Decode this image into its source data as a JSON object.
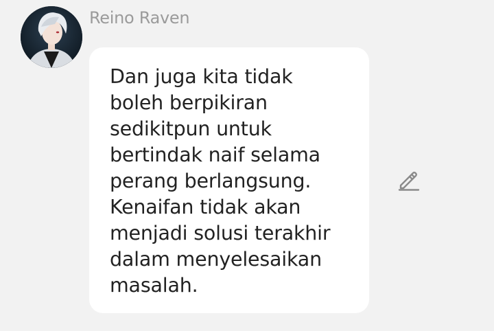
{
  "message": {
    "sender_name": "Reino Raven",
    "text": "Dan juga kita tidak\nboleh berpikiran\nsedikitpun untuk\nbertindak naif selama\nperang berlangsung.\nKenaifan tidak akan\nmenjadi solusi terakhir\ndalam menyelesaikan\nmasalah."
  },
  "icons": {
    "avatar": "anime-character-avatar",
    "edit": "pencil-edit-icon"
  },
  "colors": {
    "background": "#f2f2f2",
    "bubble": "#ffffff",
    "sender_name": "#9b9b9b",
    "message_text": "#222222",
    "edit_icon": "#8a8a8a"
  }
}
